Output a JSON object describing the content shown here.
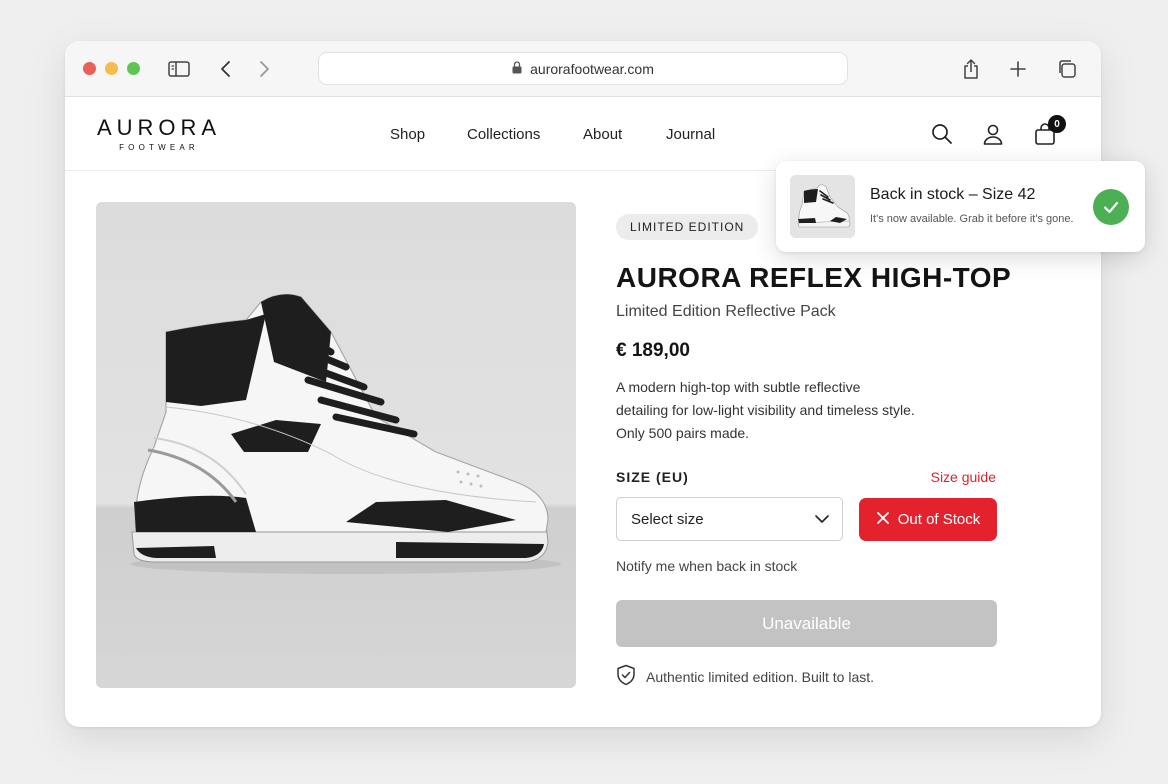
{
  "browser": {
    "url": "aurorafootwear.com"
  },
  "header": {
    "logo_main": "AURORA",
    "logo_sub": "FOOTWEAR",
    "nav": [
      "Shop",
      "Collections",
      "About",
      "Journal"
    ],
    "cart_count": "0"
  },
  "product": {
    "badge": "LIMITED EDITION",
    "title": "AURORA REFLEX HIGH-TOP",
    "subtitle": "Limited Edition Reflective Pack",
    "price": "€ 189,00",
    "description_lines": [
      "A modern high-top with subtle reflective",
      "detailing for low-light visibility and timeless style.",
      "Only 500 pairs made."
    ],
    "size_label": "SIZE (EU)",
    "size_guide": "Size guide",
    "size_select_value": "Select size",
    "stock_button": "Out of Stock",
    "notify_link": "Notify me when back in stock",
    "cta": "Unavailable",
    "trust_note": "Authentic limited edition. Built to last."
  },
  "toast": {
    "title": "Back in stock – Size 42",
    "message": "It's now available. Grab it before it's gone."
  },
  "colors": {
    "accent_red": "#e3222e",
    "success_green": "#4caf54",
    "disabled_gray": "#c3c3c3"
  },
  "icons": [
    "sidebar-icon",
    "back-icon",
    "forward-icon",
    "lock-icon",
    "share-icon",
    "new-tab-icon",
    "tabs-icon",
    "search-icon",
    "account-icon",
    "cart-icon",
    "chevron-down-icon",
    "close-icon",
    "shield-check-icon",
    "checkmark-icon"
  ]
}
